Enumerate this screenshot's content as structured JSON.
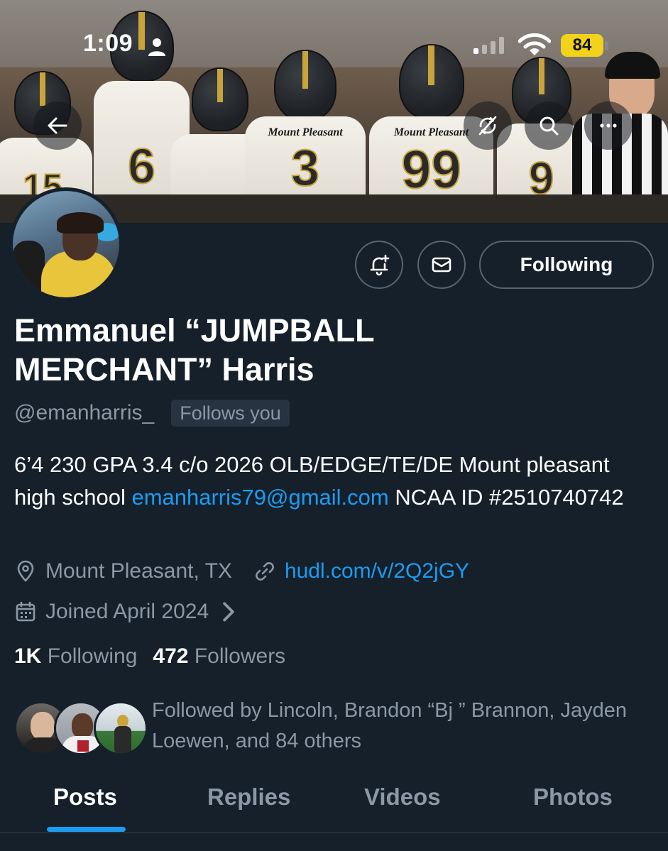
{
  "status_bar": {
    "time": "1:09",
    "battery": "84",
    "battery_color": "#f2d21a"
  },
  "banner": {
    "jersey_numbers": [
      "15",
      "6",
      "3",
      "99",
      "9"
    ],
    "jersey_text": "Mount Pleasant"
  },
  "profile": {
    "name": "Emmanuel “JUMPBALL MERCHANT” Harris",
    "handle": "@emanharris_",
    "follows_you": "Follows you",
    "bio_before": "6’4 230 GPA 3.4 c/o 2026 OLB/EDGE/TE/DE Mount pleasant high school ",
    "bio_email": "emanharris79@gmail.com",
    "bio_after": " NCAA ID #2510740742",
    "location": "Mount Pleasant, TX",
    "website": "hudl.com/v/2Q2jGY",
    "joined": "Joined April 2024",
    "following_count": "1K",
    "following_label": " Following",
    "followers_count": "472",
    "followers_label": " Followers",
    "followed_by": "Followed by Lincoln, Brandon “Bj ” Brannon, Jayden Loewen, and 84 others"
  },
  "actions": {
    "following_button": "Following"
  },
  "tabs": [
    {
      "label": "Posts",
      "active": true
    },
    {
      "label": "Replies",
      "active": false
    },
    {
      "label": "Videos",
      "active": false
    },
    {
      "label": "Photos",
      "active": false
    }
  ],
  "colors": {
    "background": "#15202b",
    "link": "#1d9bf0",
    "secondary_text": "#8b98a5"
  },
  "icons": {
    "back": "arrow-left-icon",
    "sync": "sync-off-icon",
    "search": "search-icon",
    "more": "more-icon",
    "notify": "bell-plus-icon",
    "message": "envelope-icon",
    "location": "location-pin-icon",
    "website": "link-icon",
    "joined": "calendar-icon"
  }
}
